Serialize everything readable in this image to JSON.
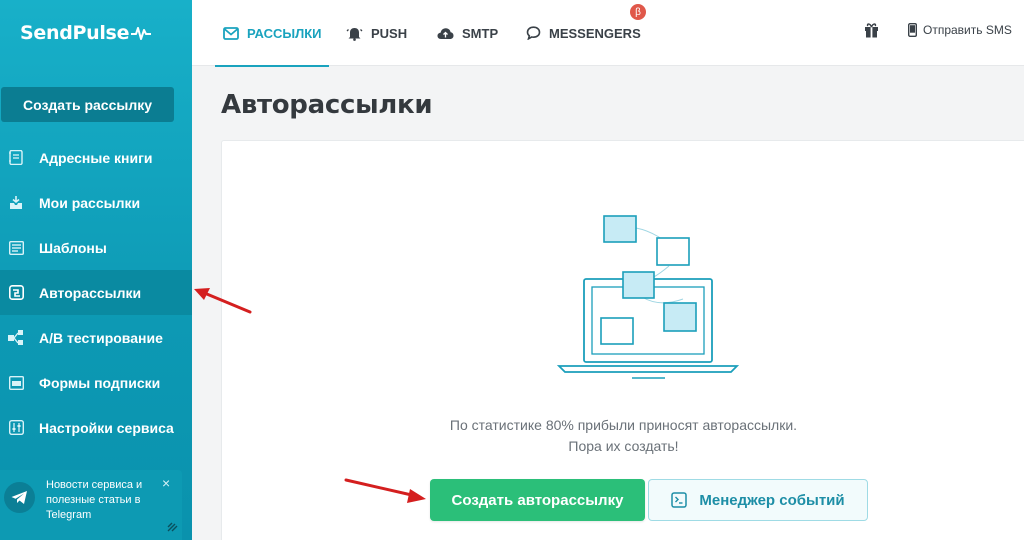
{
  "brand": {
    "name": "SendPulse"
  },
  "sidebar": {
    "create_button": "Создать рассылку",
    "items": [
      {
        "label": "Адресные книги",
        "icon": "address-book-icon"
      },
      {
        "label": "Мои рассылки",
        "icon": "campaigns-icon"
      },
      {
        "label": "Шаблоны",
        "icon": "templates-icon"
      },
      {
        "label": "Авторассылки",
        "icon": "automation-icon",
        "active": true
      },
      {
        "label": "A/B тестирование",
        "icon": "ab-test-icon"
      },
      {
        "label": "Формы подписки",
        "icon": "subscription-forms-icon"
      },
      {
        "label": "Настройки сервиса",
        "icon": "settings-icon"
      }
    ],
    "telegram_banner": {
      "text": "Новости сервиса и полезные статьи в Telegram",
      "close": "×"
    }
  },
  "topbar": {
    "tabs": [
      {
        "label": "РАССЫЛКИ",
        "icon": "email-icon",
        "active": true
      },
      {
        "label": "PUSH",
        "icon": "bell-icon"
      },
      {
        "label": "SMTP",
        "icon": "cloud-icon"
      },
      {
        "label": "MESSENGERS",
        "icon": "chat-icon"
      }
    ],
    "beta_badge": "β",
    "sms_label": "Отправить SMS"
  },
  "main": {
    "title": "Авторассылки",
    "stat_line1": "По статистике 80% прибыли приносят авторассылки.",
    "stat_line2": "Пора их создать!",
    "create_button": "Создать авторассылку",
    "events_button": "Менеджер событий"
  },
  "colors": {
    "sidebar": "#0d99b4",
    "accent": "#1aa3be",
    "green": "#2bbf79",
    "arrow": "#d41f1f"
  }
}
